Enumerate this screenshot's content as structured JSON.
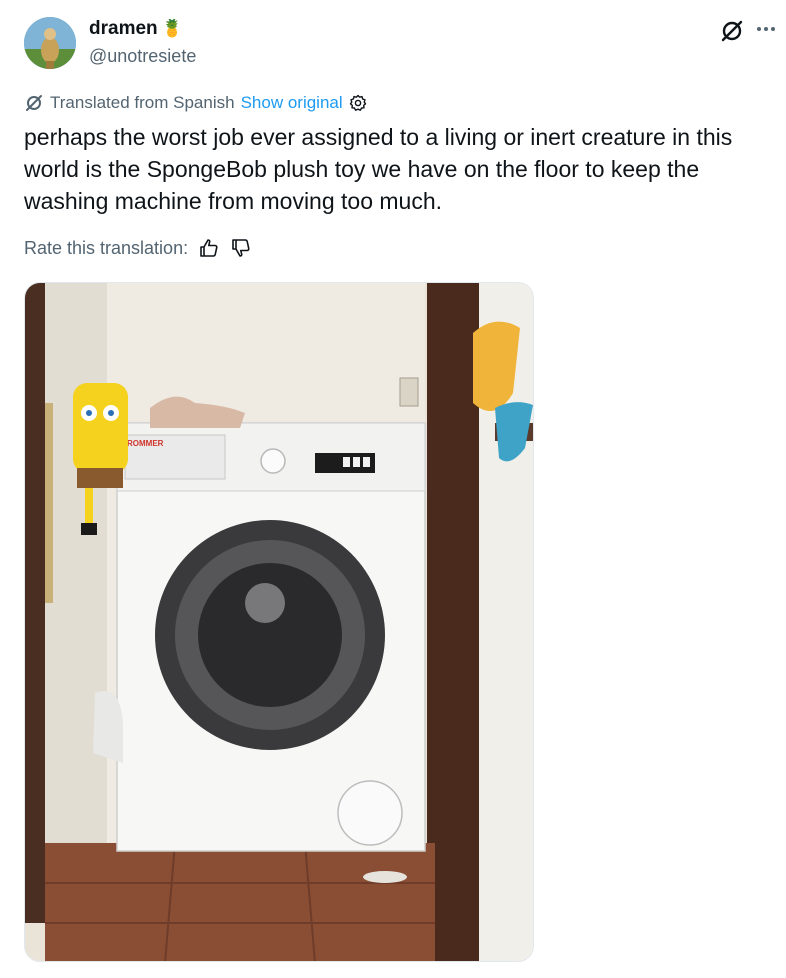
{
  "user": {
    "display_name": "dramen",
    "name_emoji": "🍍",
    "handle": "@unotresiete"
  },
  "translation": {
    "label": "Translated from Spanish",
    "show_original": "Show original"
  },
  "tweet": {
    "text": "perhaps the worst job ever assigned to a living or inert creature in this world is the SpongeBob plush toy we have on the floor to keep the washing machine from moving too much."
  },
  "rate": {
    "label": "Rate this translation:"
  },
  "photo": {
    "brand": "ROMMER"
  },
  "icons": {
    "grok": "grok-icon",
    "more": "more-icon",
    "translate": "translate-icon",
    "settings": "gear-icon",
    "thumbs_up": "thumbs-up-icon",
    "thumbs_down": "thumbs-down-icon"
  },
  "colors": {
    "link": "#1d9bf0",
    "muted": "#536471",
    "text": "#0f1419"
  }
}
